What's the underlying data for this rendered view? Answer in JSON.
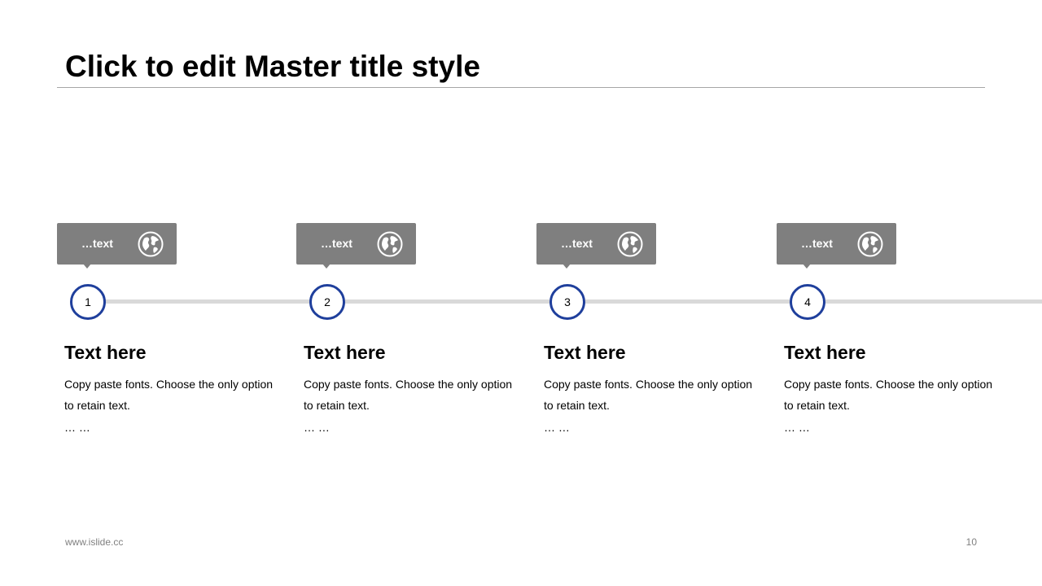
{
  "slide": {
    "title": "Click to edit Master title style"
  },
  "steps": [
    {
      "tag_label": "…text",
      "tag_icon": "globe-icon",
      "number": "1",
      "heading": "Text here",
      "body": "Copy paste fonts. Choose the only option to retain text.",
      "more": "…  …"
    },
    {
      "tag_label": "…text",
      "tag_icon": "globe-icon",
      "number": "2",
      "heading": "Text here",
      "body": "Copy paste fonts. Choose the only option to retain text.",
      "more": "…  …"
    },
    {
      "tag_label": "…text",
      "tag_icon": "globe-icon",
      "number": "3",
      "heading": "Text here",
      "body": "Copy paste fonts. Choose the only option to retain text.",
      "more": "…  …"
    },
    {
      "tag_label": "…text",
      "tag_icon": "globe-icon",
      "number": "4",
      "heading": "Text here",
      "body": "Copy paste fonts. Choose the only option to retain text.",
      "more": "…  …"
    }
  ],
  "footer": {
    "url": "www.islide.cc",
    "page_number": "10"
  },
  "colors": {
    "accent": "#1f3f9c",
    "tag_background": "#7f7f7f",
    "timeline": "#d9d9d9",
    "title_rule": "#a6a6a6"
  }
}
